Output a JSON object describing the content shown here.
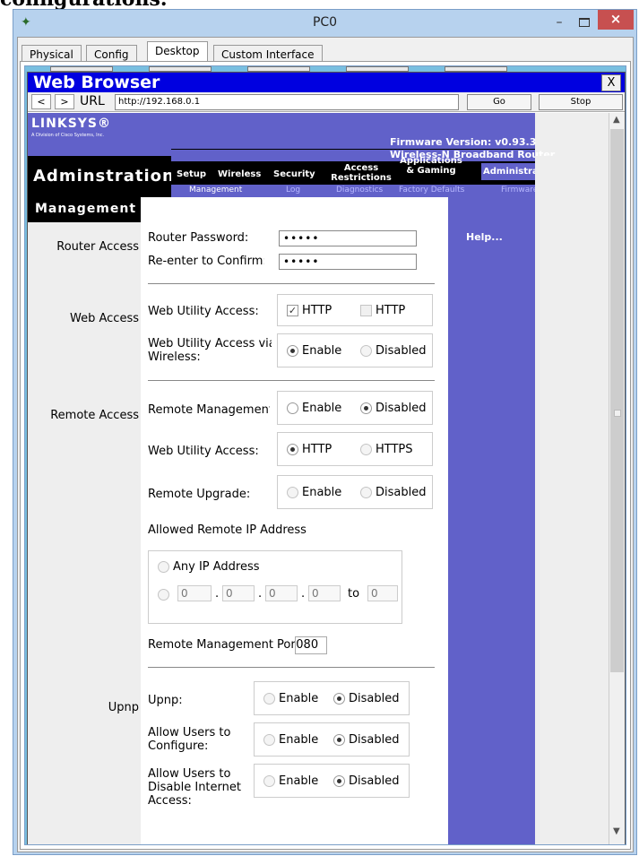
{
  "caption": "configurations.",
  "window": {
    "title": "PC0",
    "minimize": "–",
    "close": "×"
  },
  "tabs": [
    "Physical",
    "Config",
    "Desktop",
    "Custom Interface"
  ],
  "browser": {
    "title": "Web Browser",
    "close_label": "X",
    "back_label": "<",
    "forward_label": ">",
    "url_label": "URL",
    "url_value": "http://192.168.0.1",
    "go_label": "Go",
    "stop_label": "Stop"
  },
  "router_page": {
    "logo": "LINKSYS®",
    "logo_sub": "A Division of Cisco Systems, Inc.",
    "firmware": "Firmware Version: v0.93.3",
    "product": "Wireless-N Broadband Router",
    "section": "Adminstration",
    "nav": {
      "setup": "Setup",
      "wireless": "Wireless",
      "security": "Security",
      "access_1": "Access",
      "access_2": "Restrictions",
      "apps_1": "Applications",
      "apps_2": "& Gaming",
      "admin": "Administration"
    },
    "subnav": {
      "management": "Management",
      "log": "Log",
      "diagnostics": "Diagnostics",
      "factory": "Factory Defaults",
      "firmware": "Firmware Upgrade"
    },
    "subsection": "Management",
    "left_labels": {
      "router_access": "Router Access",
      "web_access": "Web Access",
      "remote_access": "Remote Access",
      "upnp": "Upnp"
    },
    "help": "Help...",
    "fields": {
      "router_password": "Router Password:",
      "router_password_value": "•••••",
      "reenter": "Re-enter to Confirm:",
      "reenter_value": "•••••",
      "web_utility_access": "Web Utility Access:",
      "http": "HTTP",
      "https": "HTTPS",
      "web_wireless_1": "Web Utility Access via",
      "web_wireless_2": "Wireless:",
      "enable": "Enable",
      "disable": "Disabled",
      "remote_management": "Remote Management:",
      "web_utility_access_remote": "Web Utility Access:",
      "remote_upgrade": "Remote Upgrade:",
      "allowed_ip": "Allowed Remote IP Address:",
      "any_ip": "Any IP Address",
      "ip_parts": [
        "0",
        "0",
        "0",
        "0"
      ],
      "ip_to": "to",
      "ip_end": "0",
      "remote_port_label": "Remote Management Port:",
      "remote_port_value": "8080",
      "upnp": "Upnp:",
      "allow_config_1": "Allow Users to",
      "allow_config_2": "Configure:",
      "allow_disable_1": "Allow Users to",
      "allow_disable_2": "Disable Internet",
      "allow_disable_3": "Access:"
    }
  },
  "colors": {
    "browser_title": "#0000e0",
    "linksys_purple": "#6161c9",
    "close_red": "#c75050"
  }
}
